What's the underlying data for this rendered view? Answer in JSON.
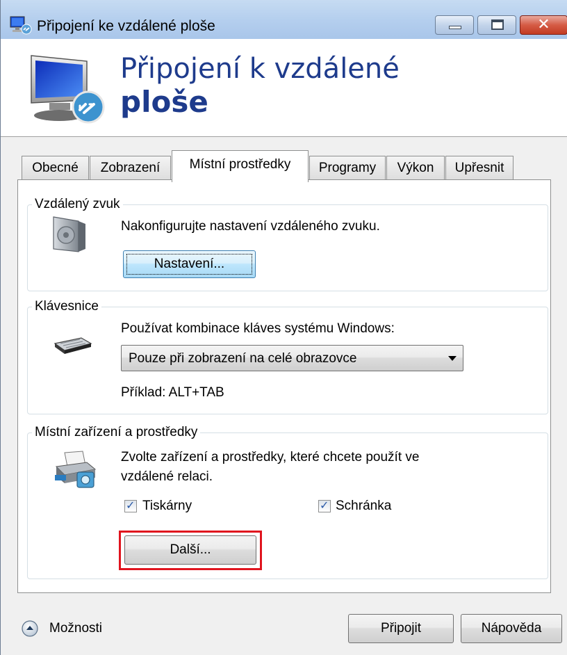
{
  "window": {
    "title": "Připojení ke vzdálené ploše",
    "close_glyph": "✕"
  },
  "banner": {
    "line1": "Připojení k vzdálené",
    "line2": "ploše"
  },
  "tabs": [
    {
      "label": "Obecné"
    },
    {
      "label": "Zobrazení"
    },
    {
      "label": "Místní prostředky"
    },
    {
      "label": "Programy"
    },
    {
      "label": "Výkon"
    },
    {
      "label": "Upřesnit"
    }
  ],
  "active_tab": "Místní prostředky",
  "audio": {
    "legend": "Vzdálený zvuk",
    "description": "Nakonfigurujte nastavení vzdáleného zvuku.",
    "settings_button": "Nastavení..."
  },
  "keyboard": {
    "legend": "Klávesnice",
    "label": "Používat kombinace kláves systému Windows:",
    "selected": "Pouze při zobrazení na celé obrazovce",
    "example": "Příklad: ALT+TAB"
  },
  "devices": {
    "legend": "Místní zařízení a prostředky",
    "description_line1": "Zvolte zařízení a prostředky, které chcete použít ve",
    "description_line2": "vzdálené relaci.",
    "printers_label": "Tiskárny",
    "printers_checked": true,
    "clipboard_label": "Schránka",
    "clipboard_checked": true,
    "more_button": "Další..."
  },
  "footer": {
    "options_label": "Možnosti",
    "connect_button": "Připojit",
    "help_button": "Nápověda"
  },
  "colors": {
    "accent_text": "#1e3b8c",
    "highlight": "#e0141e"
  }
}
